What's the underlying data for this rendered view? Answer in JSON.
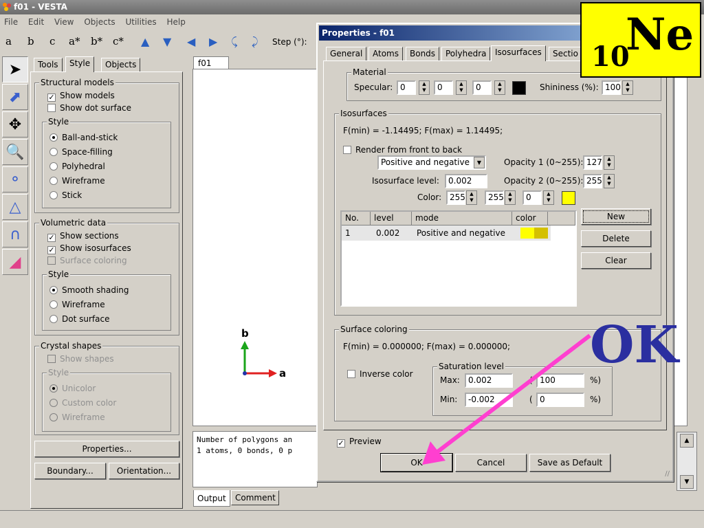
{
  "app": {
    "title": "f01 - VESTA"
  },
  "menu": [
    "File",
    "Edit",
    "View",
    "Objects",
    "Utilities",
    "Help"
  ],
  "toolbar": {
    "axis_buttons": [
      "a",
      "b",
      "c",
      "a*",
      "b*",
      "c*"
    ],
    "step_label": "Step (°):"
  },
  "left_tabs": [
    "Tools",
    "Style",
    "Objects"
  ],
  "structural_models": {
    "title": "Structural models",
    "show_models": "Show models",
    "show_dot_surface": "Show dot surface",
    "style_title": "Style",
    "styles": [
      "Ball-and-stick",
      "Space-filling",
      "Polyhedral",
      "Wireframe",
      "Stick"
    ]
  },
  "volumetric_data": {
    "title": "Volumetric data",
    "show_sections": "Show sections",
    "show_isosurfaces": "Show isosurfaces",
    "surface_coloring": "Surface coloring",
    "style_title": "Style",
    "styles": [
      "Smooth shading",
      "Wireframe",
      "Dot surface"
    ]
  },
  "crystal_shapes": {
    "title": "Crystal shapes",
    "show_shapes": "Show shapes",
    "style_title": "Style",
    "styles": [
      "Unicolor",
      "Custom color",
      "Wireframe"
    ]
  },
  "left_buttons": {
    "properties": "Properties...",
    "boundary": "Boundary...",
    "orientation": "Orientation..."
  },
  "viewer": {
    "tab": "f01",
    "axis_a": "a",
    "axis_b": "b"
  },
  "output": {
    "lines": [
      "Number of polygons an",
      "1 atoms, 0 bonds, 0 p"
    ],
    "tabs": [
      "Output",
      "Comment"
    ]
  },
  "dialog": {
    "title": "Properties - f01",
    "tabs": [
      "General",
      "Atoms",
      "Bonds",
      "Polyhedra",
      "Isosurfaces",
      "Sectio"
    ],
    "material": {
      "title": "Material",
      "specular_label": "Specular:",
      "specular_values": [
        "0",
        "0",
        "0"
      ],
      "shininess_label": "Shininess (%):",
      "shininess_value": "100"
    },
    "isosurfaces": {
      "title": "Isosurfaces",
      "f_range": "F(min) = -1.14495;   F(max) = 1.14495;",
      "render_label": "Render from front to back",
      "mode_select": "Positive and negative",
      "opacity1_label": "Opacity 1 (0~255):",
      "opacity1_value": "127",
      "opacity2_label": "Opacity 2 (0~255):",
      "opacity2_value": "255",
      "level_label": "Isosurface level:",
      "level_value": "0.002",
      "color_label": "Color:",
      "color_values": [
        "255",
        "255",
        "0"
      ],
      "table_headers": [
        "No.",
        "level",
        "mode",
        "color"
      ],
      "table_rows": [
        {
          "no": "1",
          "level": "0.002",
          "mode": "Positive and negative"
        }
      ],
      "buttons": {
        "new": "New",
        "delete": "Delete",
        "clear": "Clear"
      }
    },
    "surface_coloring": {
      "title": "Surface coloring",
      "f_range": "F(min) = 0.000000;   F(max) = 0.000000;",
      "inverse_label": "Inverse color",
      "saturation_title": "Saturation level",
      "max_label": "Max:",
      "max_value": "0.002",
      "max_pct": "100",
      "min_label": "Min:",
      "min_value": "-0.002",
      "min_pct": "0",
      "pct_open": "(",
      "pct_close": "%)"
    },
    "preview_label": "Preview",
    "buttons": {
      "ok": "OK",
      "cancel": "Cancel",
      "save_default": "Save as Default"
    }
  },
  "overlay": {
    "element_number": "10",
    "element_symbol": "Ne",
    "ok_label": "OK"
  },
  "colors": {
    "yellow": "#ffff00",
    "arrow": "#ff3fd0",
    "ok_text": "#2b2fa0",
    "title_blue": "#0a246a"
  }
}
